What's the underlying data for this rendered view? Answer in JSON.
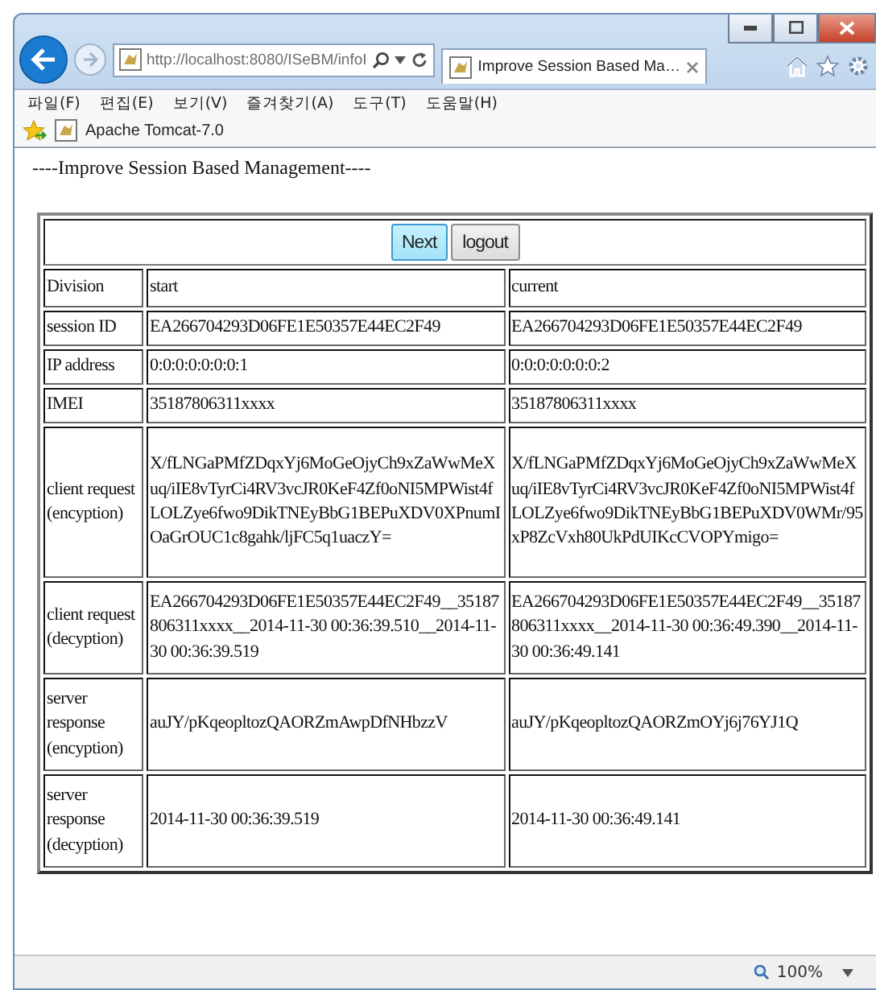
{
  "address_bar": {
    "url": "http://localhost:8080/ISeBM/infoI"
  },
  "tabs": [
    {
      "label": "Improve Session Based Ma…",
      "selected": true
    }
  ],
  "menu": [
    "파일(F)",
    "편집(E)",
    "보기(V)",
    "즐겨찾기(A)",
    "도구(T)",
    "도움말(H)"
  ],
  "favorites": [
    {
      "label": "Apache Tomcat-7.0"
    }
  ],
  "page": {
    "heading": "----Improve Session Based Management----",
    "buttons": [
      {
        "label": "Next",
        "focused": true
      },
      {
        "label": "logout",
        "focused": false
      }
    ],
    "table": {
      "columns": [
        "Division",
        "start",
        "current"
      ],
      "rows": [
        {
          "label": "session ID",
          "start": "EA266704293D06FE1E50357E44EC2F49",
          "current": "EA266704293D06FE1E50357E44EC2F49"
        },
        {
          "label": "IP address",
          "start": "0:0:0:0:0:0:0:1",
          "current": "0:0:0:0:0:0:0:2"
        },
        {
          "label": "IMEI",
          "start": "35187806311xxxx",
          "current": "35187806311xxxx"
        },
        {
          "label": "client request (encyption)",
          "start": "X/fLNGaPMfZDqxYj6MoGeOjyCh9xZaWwMeXuq/iIE8vTyrCi4RV3vcJR0KeF4Zf0oNI5MPWist4fLOLZye6fwo9DikTNEyBbG1BEPuXDV0XPnumIOaGrOUC1c8gahk/ljFC5q1uaczY=",
          "current": "X/fLNGaPMfZDqxYj6MoGeOjyCh9xZaWwMeXuq/iIE8vTyrCi4RV3vcJR0KeF4Zf0oNI5MPWist4fLOLZye6fwo9DikTNEyBbG1BEPuXDV0WMr/95xP8ZcVxh80UkPdUIKcCVOPYmigo="
        },
        {
          "label": "client request (decyption)",
          "start": "EA266704293D06FE1E50357E44EC2F49__35187806311xxxx__2014-11-30 00:36:39.510__2014-11-30 00:36:39.519",
          "current": "EA266704293D06FE1E50357E44EC2F49__35187806311xxxx__2014-11-30 00:36:49.390__2014-11-30 00:36:49.141"
        },
        {
          "label": "server response (encyption)",
          "start": "auJY/pKqeopltozQAORZmAwpDfNHbzzV",
          "current": "auJY/pKqeopltozQAORZmOYj6j76YJ1Q"
        },
        {
          "label": "server response (decyption)",
          "start": "2014-11-30 00:36:39.519",
          "current": "2014-11-30 00:36:49.141"
        }
      ]
    }
  },
  "status_bar": {
    "zoom": "100%"
  }
}
